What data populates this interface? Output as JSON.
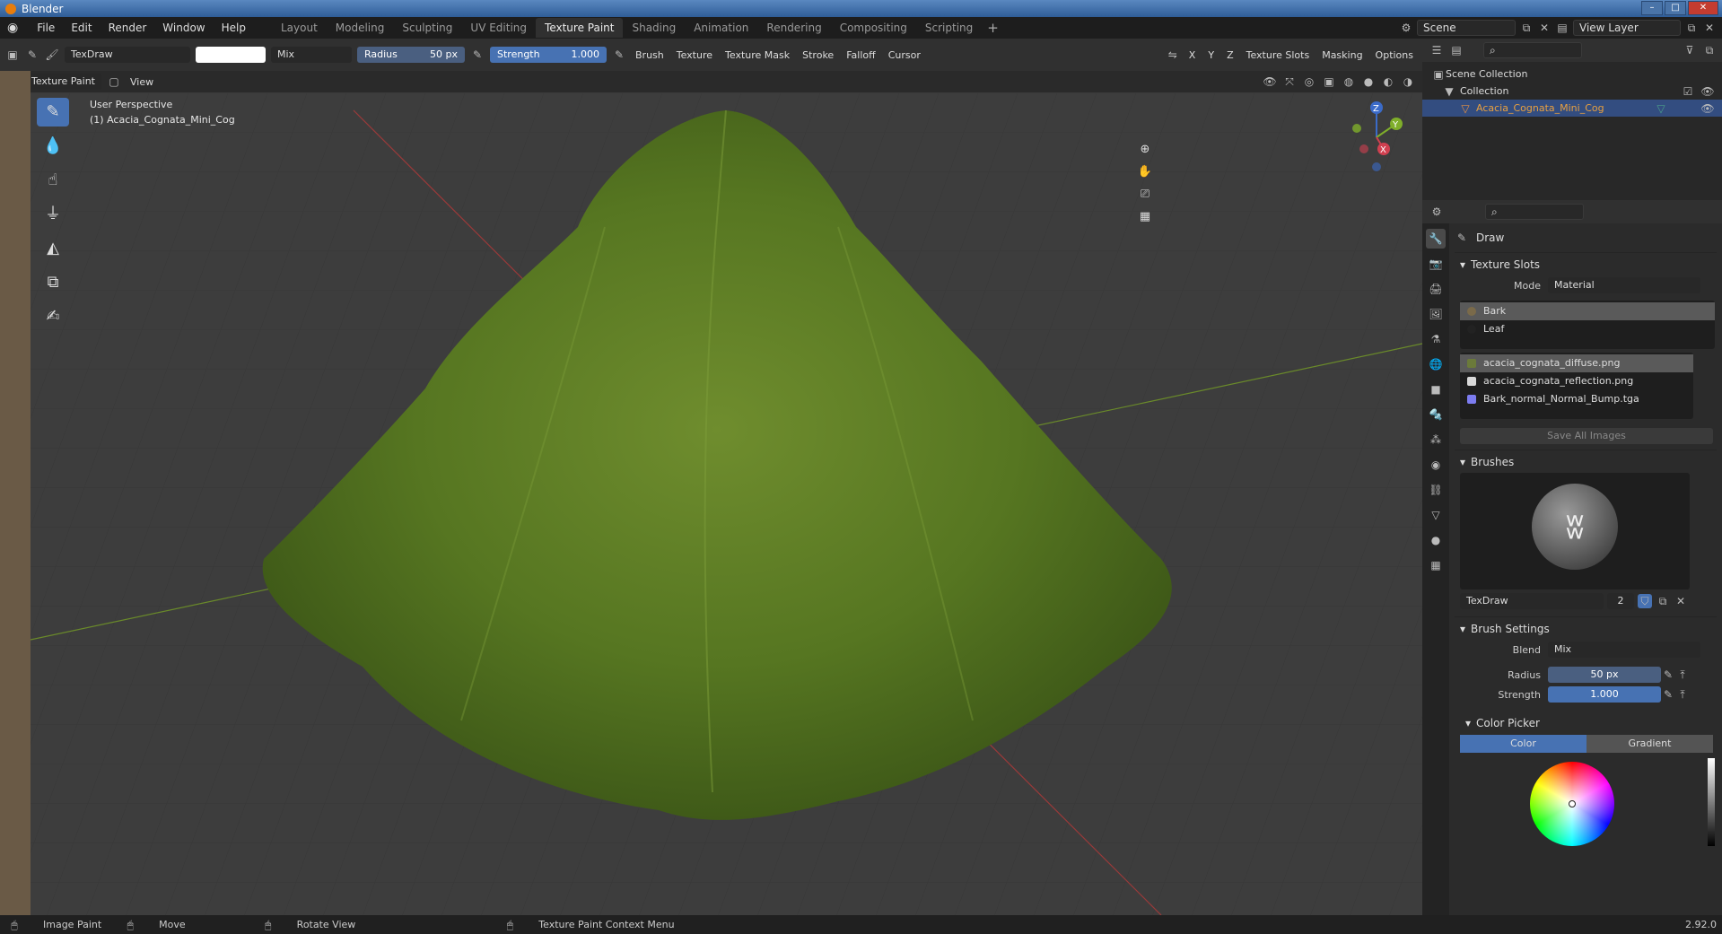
{
  "window": {
    "title": "Blender"
  },
  "menu": [
    "File",
    "Edit",
    "Render",
    "Window",
    "Help"
  ],
  "workspaces": [
    "Layout",
    "Modeling",
    "Sculpting",
    "UV Editing",
    "Texture Paint",
    "Shading",
    "Animation",
    "Rendering",
    "Compositing",
    "Scripting"
  ],
  "active_workspace": "Texture Paint",
  "scene": {
    "scene_name": "Scene",
    "view_layer": "View Layer"
  },
  "tool_header": {
    "brush_name": "TexDraw",
    "blend": "Mix",
    "radius_label": "Radius",
    "radius_value": "50 px",
    "strength_label": "Strength",
    "strength_value": "1.000",
    "menus": [
      "Brush",
      "Texture",
      "Texture Mask",
      "Stroke",
      "Falloff",
      "Cursor"
    ],
    "axes": [
      "X",
      "Y",
      "Z"
    ],
    "right_menus": [
      "Texture Slots",
      "Masking",
      "Options"
    ]
  },
  "view_header": {
    "mode": "Texture Paint",
    "view": "View"
  },
  "viewport": {
    "line1": "User Perspective",
    "line2": "(1) Acacia_Cognata_Mini_Cog",
    "gizmo": {
      "x": "X",
      "y": "Y",
      "z": "Z"
    }
  },
  "outliner": {
    "scene_collection": "Scene Collection",
    "collection": "Collection",
    "object": "Acacia_Cognata_Mini_Cog"
  },
  "properties": {
    "tool_name": "Draw",
    "texture_slots": {
      "title": "Texture Slots",
      "mode_label": "Mode",
      "mode_value": "Material",
      "materials": [
        "Bark",
        "Leaf"
      ],
      "images": [
        {
          "name": "acacia_cognata_diffuse.png",
          "color": "#6b7a3a"
        },
        {
          "name": "acacia_cognata_reflection.png",
          "color": "#d8d8d8"
        },
        {
          "name": "Bark_normal_Normal_Bump.tga",
          "color": "#7c7cf0"
        }
      ],
      "save_all": "Save All Images"
    },
    "brushes": {
      "title": "Brushes",
      "brush_name": "TexDraw",
      "users": "2"
    },
    "brush_settings": {
      "title": "Brush Settings",
      "blend_label": "Blend",
      "blend_value": "Mix",
      "radius_label": "Radius",
      "radius_value": "50 px",
      "strength_label": "Strength",
      "strength_value": "1.000"
    },
    "color_picker": {
      "title": "Color Picker",
      "tab_color": "Color",
      "tab_gradient": "Gradient"
    }
  },
  "statusbar": {
    "items": [
      "Image Paint",
      "Move",
      "Rotate View",
      "Texture Paint Context Menu"
    ],
    "version": "2.92.0"
  },
  "colors": {
    "accent": "#4772b3",
    "foliage": "#5a7a2a"
  }
}
